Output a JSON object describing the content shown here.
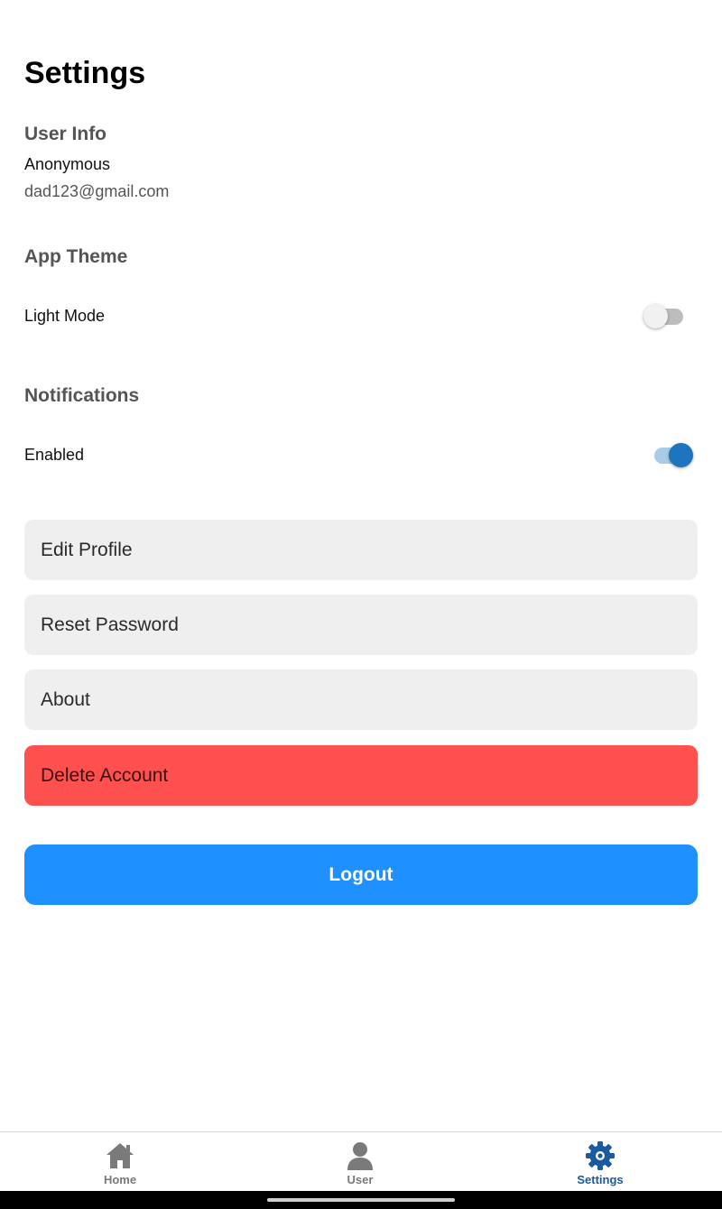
{
  "header": {
    "title": "Settings"
  },
  "user_info": {
    "section_title": "User Info",
    "name": "Anonymous",
    "email": "dad123@gmail.com"
  },
  "app_theme": {
    "section_title": "App Theme",
    "label": "Light Mode",
    "toggle_on": false
  },
  "notifications": {
    "section_title": "Notifications",
    "label": "Enabled",
    "toggle_on": true
  },
  "actions": {
    "edit_profile": "Edit Profile",
    "reset_password": "Reset Password",
    "about": "About",
    "delete_account": "Delete Account",
    "logout": "Logout"
  },
  "bottom_nav": {
    "items": [
      {
        "label": "Home",
        "icon": "home-icon",
        "active": false
      },
      {
        "label": "User",
        "icon": "user-icon",
        "active": false
      },
      {
        "label": "Settings",
        "icon": "gear-icon",
        "active": true
      }
    ]
  },
  "colors": {
    "primary": "#1e90ff",
    "danger": "#ff5050",
    "toggle_active": "#1e74bd",
    "nav_active": "#1a5aa0",
    "nav_inactive": "#7a7a7a"
  }
}
